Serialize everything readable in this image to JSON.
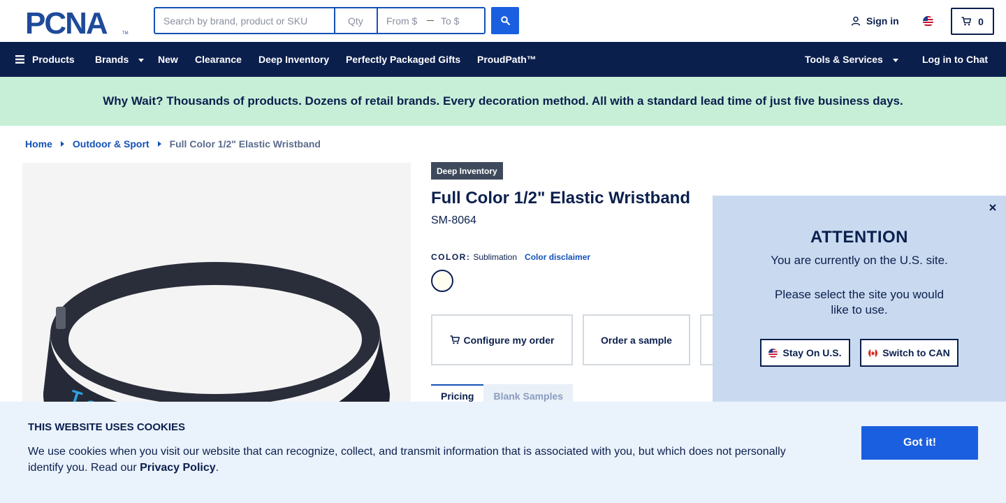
{
  "header": {
    "logo_text": "PCNA",
    "search_placeholder": "Search by brand, product or SKU",
    "qty_placeholder": "Qty",
    "from_placeholder": "From $",
    "to_placeholder": "To $",
    "signin_label": "Sign in",
    "cart_count": "0"
  },
  "nav": {
    "items": [
      {
        "label": "Products"
      },
      {
        "label": "Brands"
      },
      {
        "label": "New"
      },
      {
        "label": "Clearance"
      },
      {
        "label": "Deep Inventory"
      },
      {
        "label": "Perfectly Packaged Gifts"
      },
      {
        "label": "ProudPath™"
      }
    ],
    "tools_label": "Tools & Services",
    "chat_label": "Log in to Chat"
  },
  "banner": {
    "text": "Why Wait? Thousands of products. Dozens of retail brands. Every decoration method. All with a standard lead time of just five business days."
  },
  "breadcrumb": {
    "home": "Home",
    "category": "Outdoor & Sport",
    "current": "Full Color 1/2\" Elastic Wristband"
  },
  "product": {
    "badge": "Deep Inventory",
    "title": "Full Color 1/2\" Elastic Wristband",
    "sku": "SM-8064",
    "color_label": "COLOR:",
    "color_value": "Sublimation",
    "color_disclaimer": "Color disclaimer",
    "image_text": "Ice Hockey Club",
    "actions": {
      "configure": "Configure my order",
      "sample": "Order a sample"
    },
    "tabs": [
      "Pricing",
      "Blank Samples"
    ]
  },
  "popup": {
    "title": "ATTENTION",
    "line1": "You are currently on the U.S. site.",
    "line2": "Please select the site you would",
    "line3": "like to use.",
    "stay_label": "Stay On U.S.",
    "switch_label": "Switch to CAN"
  },
  "cookie": {
    "title": "THIS WEBSITE USES COOKIES",
    "text_line1": "We use cookies when you visit our website that can recognize, collect, and transmit information that is associated with you, but which does not personally",
    "text_line2_pre": "identify you. Read our",
    "privacy_link": "Privacy Policy",
    "text_line2_post": ".",
    "button_label": "Got it!"
  },
  "colors": {
    "navy": "#0b1f4d",
    "accent_blue": "#1a5fe0",
    "banner_green": "#c7efd7",
    "popup_blue": "#c9daf0",
    "cookie_bg": "#eaf2fc"
  }
}
